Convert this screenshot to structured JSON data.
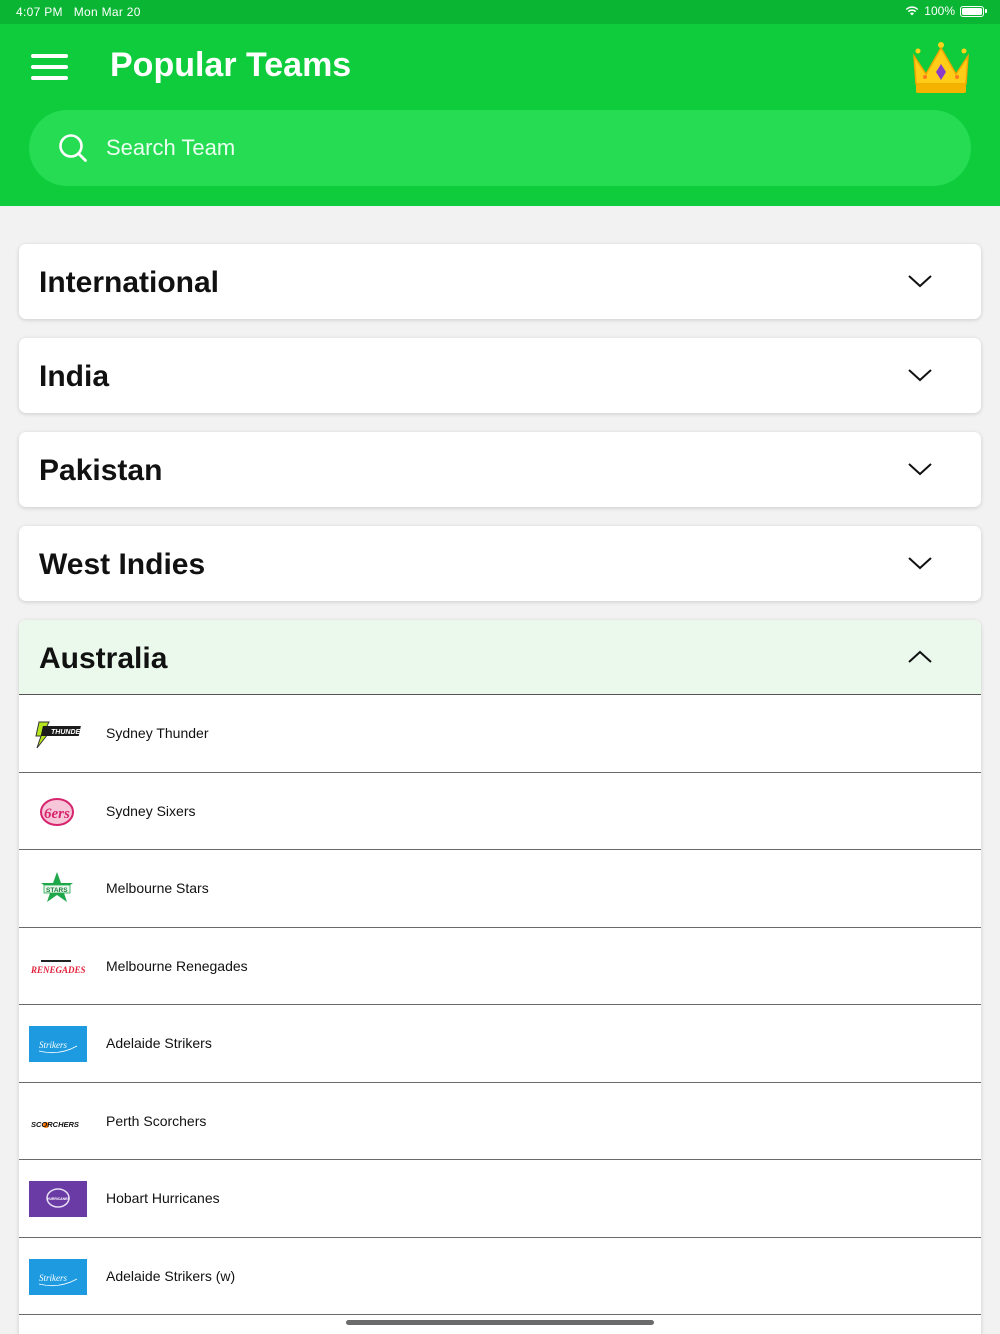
{
  "status_bar": {
    "time": "4:07 PM",
    "date": "Mon Mar 20",
    "battery": "100%"
  },
  "header": {
    "title": "Popular Teams",
    "menu_icon": "hamburger-menu-icon",
    "premium_icon": "crown-icon"
  },
  "search": {
    "placeholder": "Search Team",
    "value": ""
  },
  "sections": [
    {
      "label": "International",
      "expanded": false
    },
    {
      "label": "India",
      "expanded": false
    },
    {
      "label": "Pakistan",
      "expanded": false
    },
    {
      "label": "West Indies",
      "expanded": false
    },
    {
      "label": "Australia",
      "expanded": true
    }
  ],
  "australia_teams": [
    {
      "name": "Sydney Thunder",
      "logo_text": "THUNDER"
    },
    {
      "name": "Sydney Sixers",
      "logo_text": "6ers"
    },
    {
      "name": "Melbourne Stars",
      "logo_text": "STARS"
    },
    {
      "name": "Melbourne Renegades",
      "logo_text": "RENEGADES"
    },
    {
      "name": "Adelaide Strikers",
      "logo_text": "Strikers"
    },
    {
      "name": "Perth Scorchers",
      "logo_text": "SCORCHERS"
    },
    {
      "name": "Hobart Hurricanes",
      "logo_text": "HURRICANES"
    },
    {
      "name": "Adelaide Strikers (w)",
      "logo_text": "Strikers"
    }
  ],
  "colors": {
    "header_green": "#0fcc3c",
    "status_green": "#0ab533",
    "search_green": "#25dc52",
    "expanded_bg": "#ebf9ed",
    "page_bg": "#f2f2f2"
  }
}
